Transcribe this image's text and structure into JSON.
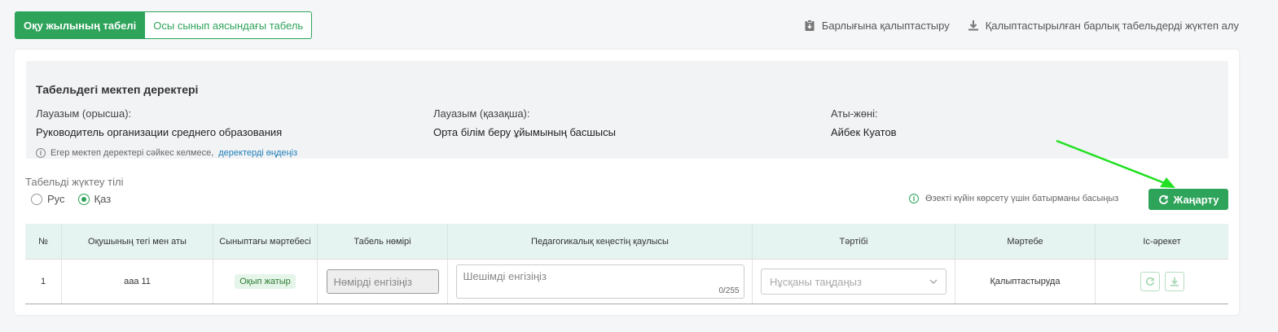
{
  "tabs": {
    "active": "Оқу жылының табелі",
    "inactive": "Осы сынып аясындағы табель"
  },
  "top_actions": {
    "standardize_all": "Барлығына қалыптастыру",
    "download_all": "Қалыптастырылған барлық табельдерді жүктеп алу"
  },
  "school_info": {
    "title": "Табельдегі мектеп деректері",
    "position_ru_label": "Лауазым (орысша):",
    "position_ru_value": "Руководитель организации среднего образования",
    "position_kz_label": "Лауазым (қазақша):",
    "position_kz_value": "Орта білім беру ұйымының басшысы",
    "name_label": "Аты-жөні:",
    "name_value": "Айбек Куатов",
    "note_text": "Егер мектеп деректері сәйкес келмесе,",
    "note_link": "деректерді өңдеңіз"
  },
  "language": {
    "label": "Табельді жүктеу тілі",
    "options": [
      "Рус",
      "Қаз"
    ],
    "selected": "Қаз"
  },
  "hint": "Өзекті күйін көрсету үшін батырманы басыңыз",
  "refresh_button": "Жаңарту",
  "table": {
    "headers": [
      "№",
      "Оқушының тегі мен аты",
      "Сыныптағы мәртебесі",
      "Табель нөмірі",
      "Педагогикалық кеңестің қаулысы",
      "Тәртібі",
      "Мәртебе",
      "Іс-әрекет"
    ],
    "rows": [
      {
        "num": "1",
        "name": "aaa 11",
        "class_status": "Оқып жатыр",
        "number_placeholder": "Нөмірді енгізіңіз",
        "decision_placeholder": "Шешімді енгізіңіз",
        "decision_counter": "0/255",
        "conduct_placeholder": "Нұсқаны таңдаңыз",
        "status": "Қалыптастыруда"
      }
    ]
  },
  "colors": {
    "accent": "#2ea35a",
    "arrow": "#22e022",
    "header_bg": "#e6f4f1"
  }
}
